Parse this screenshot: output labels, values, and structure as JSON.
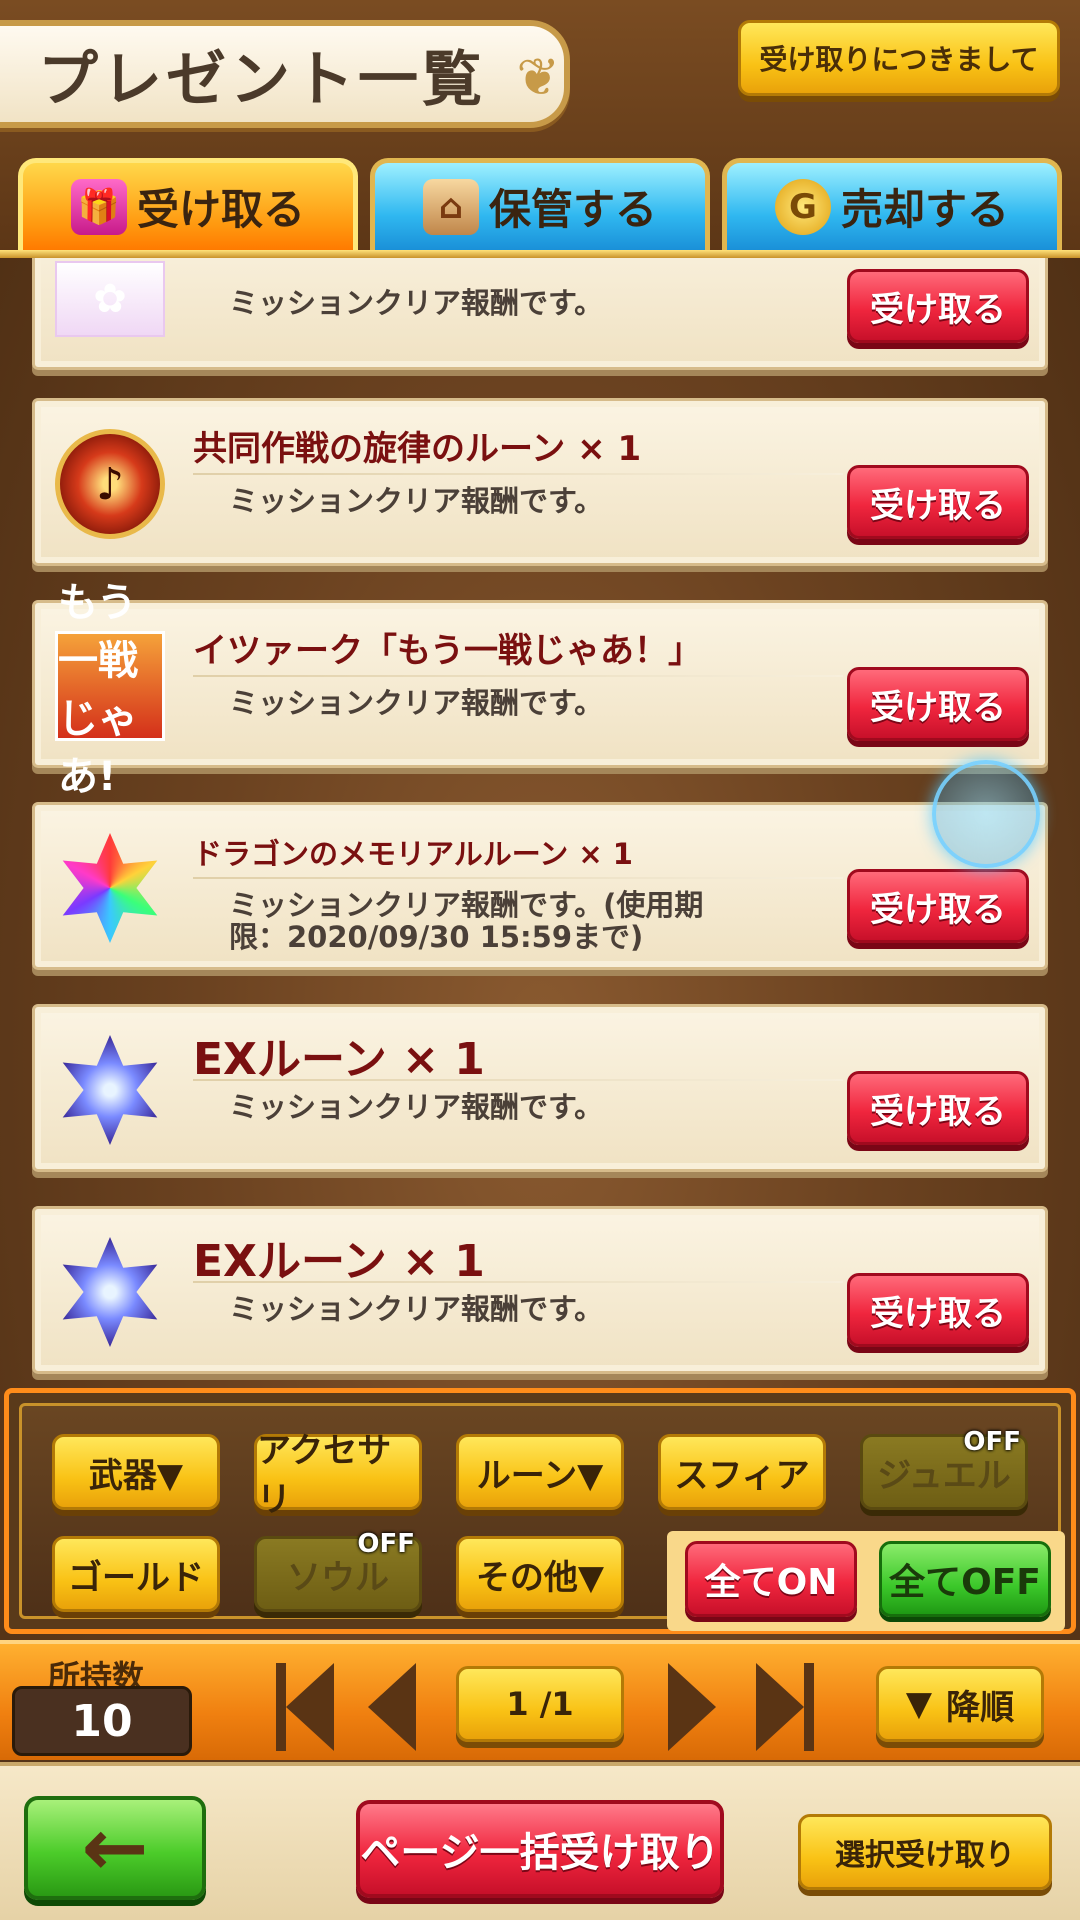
{
  "header": {
    "title": "プレゼント一覧",
    "about_button": "受け取りにつきまして"
  },
  "tabs": [
    {
      "label": "受け取る",
      "icon": "gift-icon",
      "active": true
    },
    {
      "label": "保管する",
      "icon": "house-icon",
      "active": false
    },
    {
      "label": "売却する",
      "icon": "gold-coin-icon",
      "active": false
    }
  ],
  "items": [
    {
      "name": "",
      "description": "ミッションクリア報酬です。",
      "icon": "character-sticker-icon",
      "button": "受け取る"
    },
    {
      "name": "共同作戦の旋律のルーン × 1",
      "description": "ミッションクリア報酬です。",
      "icon": "red-rune-icon",
      "button": "受け取る"
    },
    {
      "name": "イツァーク「もう一戦じゃあ！」",
      "description": "ミッションクリア報酬です。",
      "icon": "character-portrait-icon",
      "thumb_text": "もう一戦じゃあ!",
      "button": "受け取る"
    },
    {
      "name": "ドラゴンのメモリアルルーン × 1",
      "description": "ミッションクリア報酬です。(使用期限：2020/09/30 15:59まで)",
      "icon": "rainbow-star-rune-icon",
      "button": "受け取る"
    },
    {
      "name": "EXルーン × 1",
      "description": "ミッションクリア報酬です。",
      "icon": "ex-rune-icon",
      "button": "受け取る"
    },
    {
      "name": "EXルーン × 1",
      "description": "ミッションクリア報酬です。",
      "icon": "ex-rune-icon",
      "button": "受け取る"
    }
  ],
  "filters": {
    "row1": [
      {
        "label": "武器▼",
        "off": false
      },
      {
        "label": "アクセサリ",
        "off": false
      },
      {
        "label": "ルーン▼",
        "off": false
      },
      {
        "label": "スフィア",
        "off": false
      },
      {
        "label": "ジュエル",
        "off": true
      }
    ],
    "row2": [
      {
        "label": "ゴールド",
        "off": false
      },
      {
        "label": "ソウル",
        "off": true
      },
      {
        "label": "その他▼",
        "off": false
      }
    ],
    "off_badge": "OFF",
    "all_on": "全てON",
    "all_off": "全てOFF"
  },
  "paging": {
    "count_label": "所持数",
    "count_value": "10",
    "page": "1 /1",
    "sort_label": "降順",
    "sort_icon": "▼"
  },
  "footer": {
    "back_icon": "←",
    "bulk_receive": "ページ一括受け取り",
    "select_receive": "選択受け取り"
  }
}
